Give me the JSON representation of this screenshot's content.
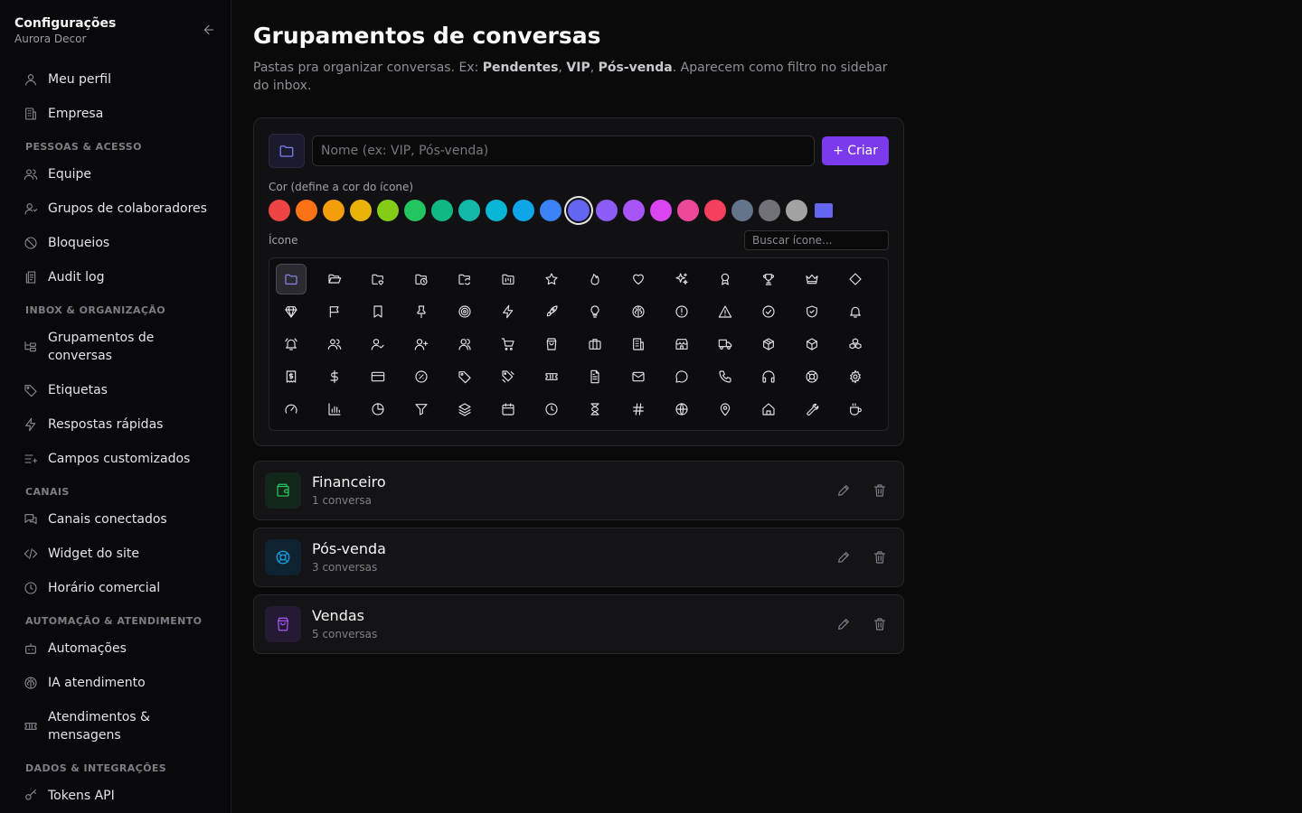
{
  "sidebar": {
    "title": "Configurações",
    "subtitle": "Aurora Decor",
    "top_items": [
      {
        "label": "Meu perfil",
        "icon": "user-icon"
      },
      {
        "label": "Empresa",
        "icon": "building-icon"
      }
    ],
    "sections": [
      {
        "title": "PESSOAS & ACESSO",
        "items": [
          {
            "label": "Equipe",
            "icon": "users-icon"
          },
          {
            "label": "Grupos de colaboradores",
            "icon": "user-group-icon"
          },
          {
            "label": "Bloqueios",
            "icon": "ban-icon"
          },
          {
            "label": "Audit log",
            "icon": "log-icon"
          }
        ]
      },
      {
        "title": "INBOX & ORGANIZAÇÃO",
        "items": [
          {
            "label": "Grupamentos de conversas",
            "icon": "folder-tree-icon"
          },
          {
            "label": "Etiquetas",
            "icon": "tag-icon"
          },
          {
            "label": "Respostas rápidas",
            "icon": "zap-icon"
          },
          {
            "label": "Campos customizados",
            "icon": "list-plus-icon"
          }
        ]
      },
      {
        "title": "CANAIS",
        "items": [
          {
            "label": "Canais conectados",
            "icon": "messages-icon"
          },
          {
            "label": "Widget do site",
            "icon": "code-icon"
          },
          {
            "label": "Horário comercial",
            "icon": "clock-icon"
          }
        ]
      },
      {
        "title": "AUTOMAÇÃO & ATENDIMENTO",
        "items": [
          {
            "label": "Automações",
            "icon": "bot-icon"
          },
          {
            "label": "IA atendimento",
            "icon": "brain-icon"
          },
          {
            "label": "Atendimentos & mensagens",
            "icon": "ticket-icon"
          }
        ]
      },
      {
        "title": "DADOS & INTEGRAÇÕES",
        "items": [
          {
            "label": "Tokens API",
            "icon": "key-icon"
          }
        ]
      }
    ]
  },
  "page": {
    "title": "Grupamentos de conversas",
    "desc_prefix": "Pastas pra organizar conversas. Ex: ",
    "desc_ex1": "Pendentes",
    "desc_sep1": ", ",
    "desc_ex2": "VIP",
    "desc_sep2": ", ",
    "desc_ex3": "Pós-venda",
    "desc_suffix": ". Aparecem como filtro no sidebar do inbox."
  },
  "form": {
    "name_placeholder": "Nome (ex: VIP, Pós-venda)",
    "create_label": "+ Criar",
    "color_label": "Cor (define a cor do ícone)",
    "icon_label": "Ícone",
    "icon_search_placeholder": "Buscar ícone...",
    "colors": [
      "#ef4444",
      "#f97316",
      "#f59e0b",
      "#eab308",
      "#84cc16",
      "#22c55e",
      "#10b981",
      "#14b8a6",
      "#06b6d4",
      "#0ea5e9",
      "#3b82f6",
      "#6366f1",
      "#8b5cf6",
      "#a855f7",
      "#d946ef",
      "#ec4899",
      "#f43f5e",
      "#64748b",
      "#71717a",
      "#a3a3a3"
    ],
    "selected_color": "#6366f1",
    "custom_color": "#6366f1",
    "icons": [
      "folder",
      "folder-open",
      "folder-heart",
      "folder-clock",
      "folder-sync",
      "folder-kanban",
      "star",
      "flame",
      "heart",
      "sparkles",
      "award",
      "trophy",
      "crown",
      "diamond",
      "gem",
      "flag",
      "bookmark",
      "pin",
      "target",
      "zap",
      "rocket",
      "lightbulb",
      "brain",
      "alert-circle",
      "alert-triangle",
      "check-circle",
      "shield-check",
      "bell",
      "bell-ring",
      "users",
      "user-check",
      "user-plus",
      "contact",
      "shopping-cart",
      "shopping-bag",
      "briefcase",
      "building",
      "store",
      "truck",
      "package",
      "box",
      "boxes",
      "receipt",
      "dollar",
      "credit-card",
      "badge-percent",
      "tag",
      "tags",
      "ticket",
      "file-text",
      "mail",
      "message-circle",
      "phone",
      "headphones",
      "life-buoy",
      "settings",
      "gauge",
      "bar-chart",
      "pie-chart",
      "filter",
      "layers",
      "calendar",
      "clock",
      "hourglass",
      "hash",
      "globe",
      "map-pin",
      "home",
      "wrench",
      "coffee"
    ],
    "selected_icon": "folder"
  },
  "groups": [
    {
      "name": "Financeiro",
      "count": "1 conversa",
      "icon": "wallet",
      "color": "#22c55e",
      "bg": "#12261a"
    },
    {
      "name": "Pós-venda",
      "count": "3 conversas",
      "icon": "life-buoy",
      "color": "#0ea5e9",
      "bg": "#0e2230"
    },
    {
      "name": "Vendas",
      "count": "5 conversas",
      "icon": "shopping-bag",
      "color": "#a855f7",
      "bg": "#241a33"
    }
  ]
}
